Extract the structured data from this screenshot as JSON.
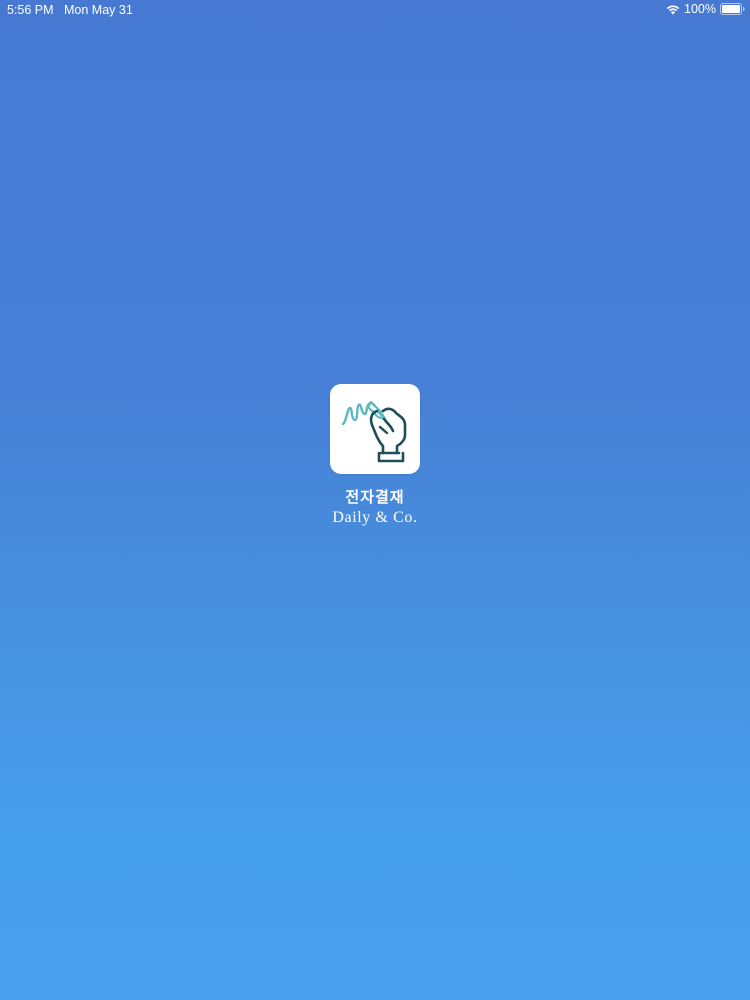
{
  "status_bar": {
    "time": "5:56 PM",
    "date": "Mon May 31",
    "battery_percent": "100%",
    "wifi_icon": "wifi-icon",
    "battery_icon": "battery-full-icon"
  },
  "splash": {
    "app_icon": "hand-signature-pen-icon",
    "title": "전자결재",
    "subtitle": "Daily & Co."
  },
  "colors": {
    "background_top": "#4779d3",
    "background_bottom": "#4aa0ec",
    "icon_stroke_light": "#5fb7c2",
    "icon_stroke_dark": "#1f4d5c",
    "text": "#ffffff"
  }
}
